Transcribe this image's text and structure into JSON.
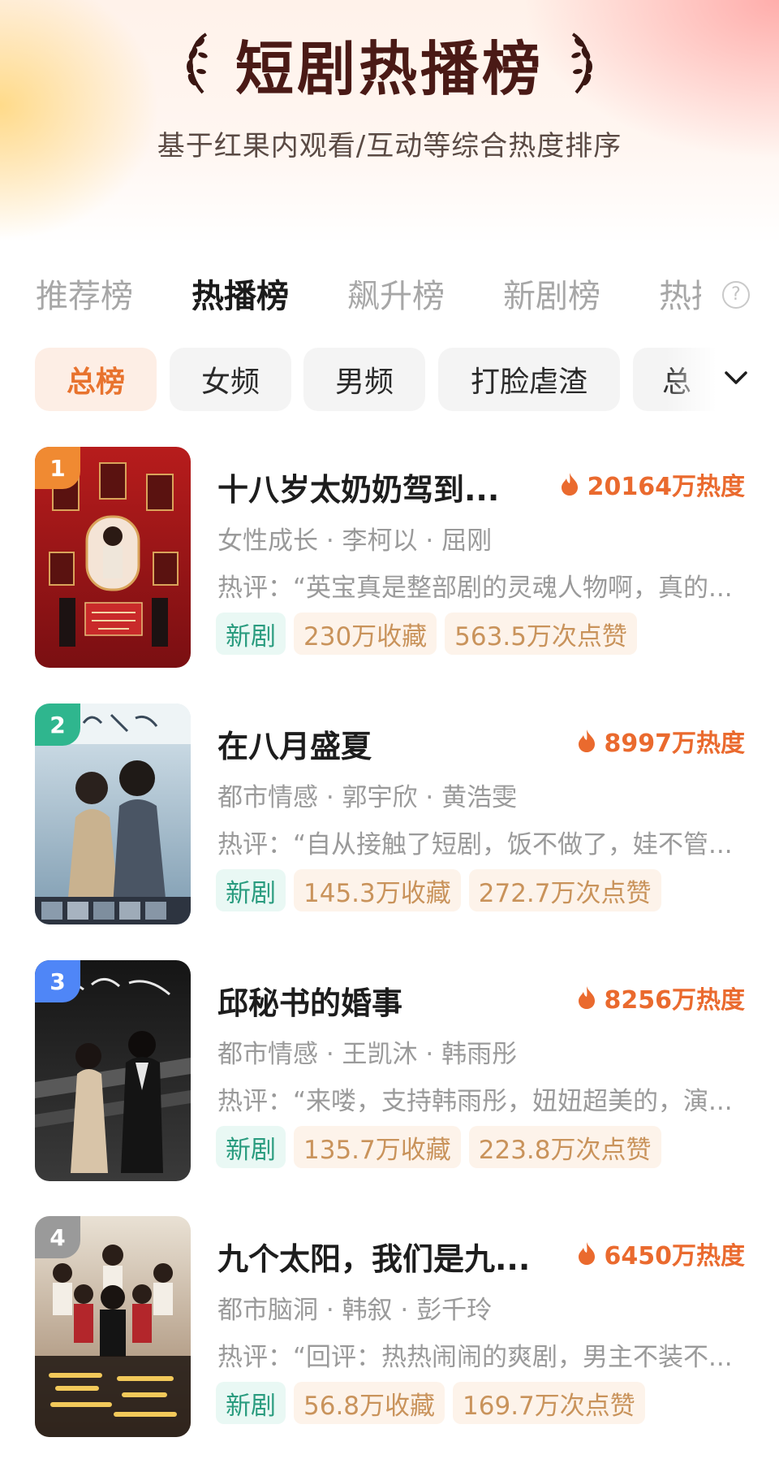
{
  "header": {
    "title": "短剧热播榜",
    "subtitle": "基于红果内观看/互动等综合热度排序"
  },
  "tabs": [
    {
      "label": "推荐榜",
      "active": false
    },
    {
      "label": "热播榜",
      "active": true
    },
    {
      "label": "飙升榜",
      "active": false
    },
    {
      "label": "新剧榜",
      "active": false
    },
    {
      "label": "热播",
      "active": false
    }
  ],
  "help_icon": "question-icon",
  "filters": [
    {
      "label": "总榜",
      "active": true
    },
    {
      "label": "女频",
      "active": false
    },
    {
      "label": "男频",
      "active": false
    },
    {
      "label": "打脸虐渣",
      "active": false
    },
    {
      "label": "总",
      "active": false
    }
  ],
  "expand_icon": "chevron-down-icon",
  "colors": {
    "accent": "#ea6a2e",
    "rank_1": "#f08a32",
    "rank_2": "#2fb68e",
    "rank_3": "#4f86f7",
    "rank_4": "#9a9a9a"
  },
  "items": [
    {
      "rank": "1",
      "title": "十八岁太奶奶驾到...",
      "heat": "20164万热度",
      "meta": "女性成长 · 李柯以 · 屈刚",
      "review": "热评：“英宝真是整部剧的灵魂人物啊，真的...",
      "tag_new": "新剧",
      "favorites": "230万收藏",
      "likes": "563.5万次点赞"
    },
    {
      "rank": "2",
      "title": "在八月盛夏",
      "heat": "8997万热度",
      "meta": "都市情感 · 郭宇欣 · 黄浩雯",
      "review": "热评：“自从接触了短剧，饭不做了，娃不管...",
      "tag_new": "新剧",
      "favorites": "145.3万收藏",
      "likes": "272.7万次点赞"
    },
    {
      "rank": "3",
      "title": "邱秘书的婚事",
      "heat": "8256万热度",
      "meta": "都市情感 · 王凯沐 · 韩雨彤",
      "review": "热评：“来喽，支持韩雨彤，妞妞超美的，演...",
      "tag_new": "新剧",
      "favorites": "135.7万收藏",
      "likes": "223.8万次点赞"
    },
    {
      "rank": "4",
      "title": "九个太阳，我们是九...",
      "heat": "6450万热度",
      "meta": "都市脑洞 · 韩叙 · 彭千玲",
      "review": "热评：“回评：热热闹闹的爽剧，男主不装不...",
      "tag_new": "新剧",
      "favorites": "56.8万收藏",
      "likes": "169.7万次点赞"
    }
  ]
}
